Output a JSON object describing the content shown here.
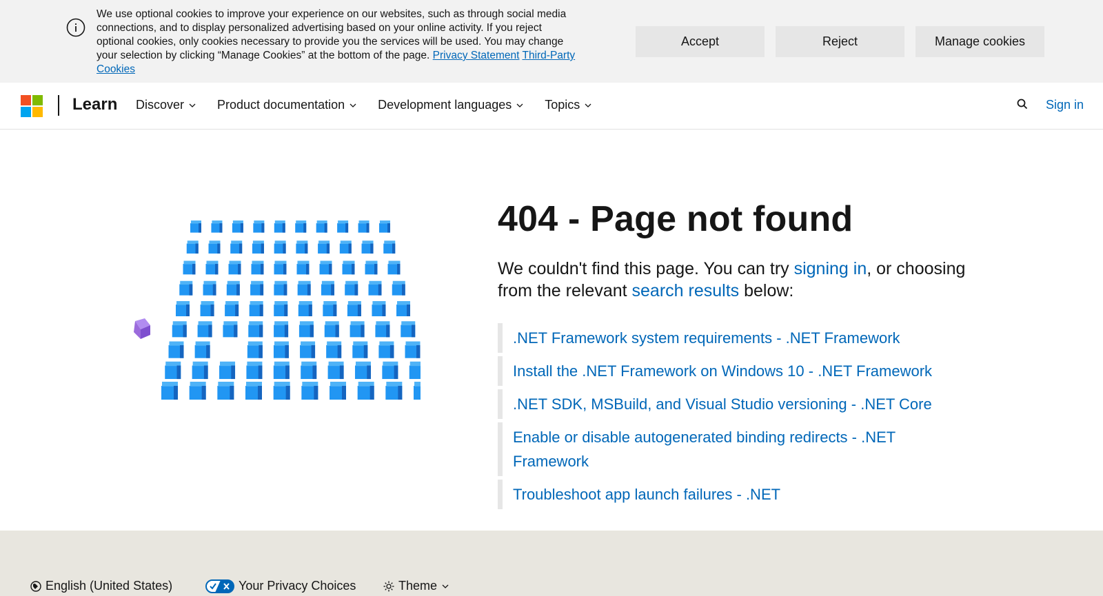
{
  "cookie_banner": {
    "text": "We use optional cookies to improve your experience on our websites, such as through social media connections, and to display personalized advertising based on your online activity. If you reject optional cookies, only cookies necessary to provide you the services will be used. You may change your selection by clicking “Manage Cookies” at the bottom of the page.",
    "privacy_link": "Privacy Statement",
    "third_party_link": "Third-Party Cookies",
    "accept_label": "Accept",
    "reject_label": "Reject",
    "manage_label": "Manage cookies"
  },
  "header": {
    "brand": "Learn",
    "nav": [
      {
        "label": "Discover"
      },
      {
        "label": "Product documentation"
      },
      {
        "label": "Development languages"
      },
      {
        "label": "Topics"
      }
    ],
    "signin_label": "Sign in"
  },
  "main": {
    "title": "404 - Page not found",
    "lead_1": "We couldn't find this page. You can try ",
    "lead_link_1": "signing in",
    "lead_2": ", or choosing from the relevant ",
    "lead_link_2": "search results",
    "lead_3": " below:",
    "results": [
      ".NET Framework system requirements - .NET Framework",
      "Install the .NET Framework on Windows 10 - .NET Framework",
      ".NET SDK, MSBuild, and Visual Studio versioning - .NET Core",
      "Enable or disable autogenerated binding redirects - .NET Framework",
      "Troubleshoot app launch failures - .NET"
    ]
  },
  "footer": {
    "language": "English (United States)",
    "privacy": "Your Privacy Choices",
    "theme": "Theme"
  },
  "colors": {
    "accent": "#0067b8",
    "cube": "#2196f3",
    "cube_odd": "#9b6bdc"
  }
}
